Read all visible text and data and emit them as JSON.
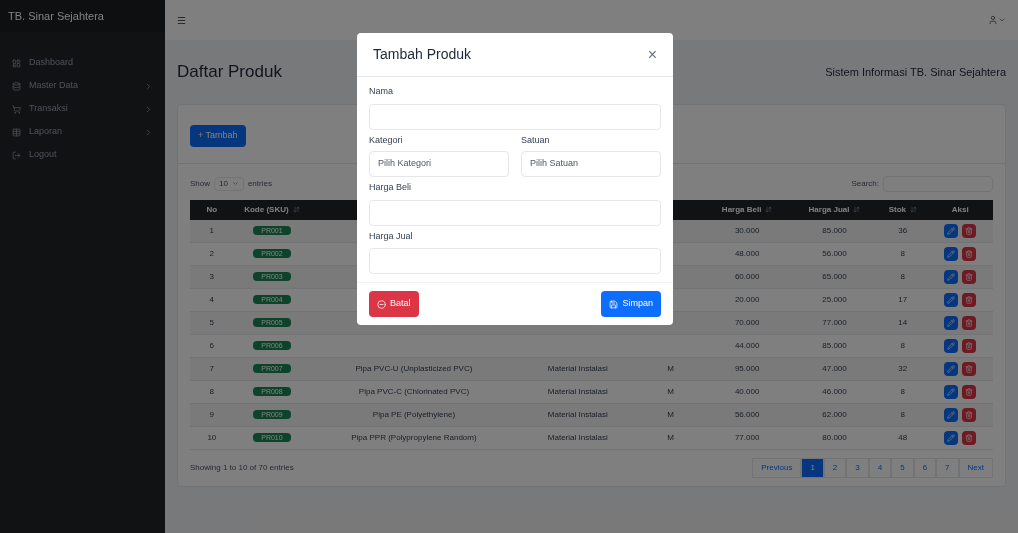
{
  "sidebar": {
    "brand": "TB. Sinar Sejahtera",
    "items": [
      {
        "label": "Dashboard",
        "has_submenu": false
      },
      {
        "label": "Master Data",
        "has_submenu": true
      },
      {
        "label": "Transaksi",
        "has_submenu": true
      },
      {
        "label": "Laporan",
        "has_submenu": true
      },
      {
        "label": "Logout",
        "has_submenu": false
      }
    ]
  },
  "topbar": {
    "menu": "☰"
  },
  "page": {
    "title": "Daftar Produk",
    "subtitle": "Sistem Informasi TB. Sinar Sejahtera"
  },
  "card": {
    "add_button": "+ Tambah",
    "show_label": "Show",
    "page_size": "10",
    "entries_label": "entries",
    "search_label": "Search:",
    "columns": [
      {
        "label": "No",
        "sortable": false
      },
      {
        "label": "Kode (SKU)",
        "sortable": true
      },
      {},
      {},
      {},
      {
        "label": "Harga Beli",
        "sortable": true
      },
      {
        "label": "Harga Jual",
        "sortable": true
      },
      {
        "label": "Stok",
        "sortable": true
      },
      {
        "label": "Aksi",
        "sortable": false
      }
    ],
    "rows": [
      {
        "no": "1",
        "code": "PR001",
        "buy": "30.000",
        "sell": "85.000",
        "stock": "36"
      },
      {
        "no": "2",
        "code": "PR002",
        "buy": "48.000",
        "sell": "56.000",
        "stock": "8"
      },
      {
        "no": "3",
        "code": "PR003",
        "buy": "60.000",
        "sell": "65.000",
        "stock": "8"
      },
      {
        "no": "4",
        "code": "PR004",
        "buy": "20.000",
        "sell": "25.000",
        "stock": "17"
      },
      {
        "no": "5",
        "code": "PR005",
        "buy": "70.000",
        "sell": "77.000",
        "stock": "14"
      },
      {
        "no": "6",
        "code": "PR006",
        "buy": "44.000",
        "sell": "85.000",
        "stock": "8"
      },
      {
        "no": "7",
        "code": "PR007",
        "name": "Pipa PVC-U (Unplasticized PVC)",
        "category": "Material Instalasi",
        "unit": "M",
        "buy": "95.000",
        "sell": "47.000",
        "stock": "32"
      },
      {
        "no": "8",
        "code": "PR008",
        "name": "Pipa PVC-C (Chlorinated PVC)",
        "category": "Material Instalasi",
        "unit": "M",
        "buy": "40.000",
        "sell": "46.000",
        "stock": "8"
      },
      {
        "no": "9",
        "code": "PR009",
        "name": "Pipa PE (Polyethylene)",
        "category": "Material Instalasi",
        "unit": "M",
        "buy": "56.000",
        "sell": "62.000",
        "stock": "8"
      },
      {
        "no": "10",
        "code": "PR010",
        "name": "Pipa PPR (Polypropylene Random)",
        "category": "Material Instalasi",
        "unit": "M",
        "buy": "77.000",
        "sell": "80.000",
        "stock": "48"
      }
    ],
    "info": "Showing 1 to 10 of 70 entries",
    "pagination": [
      {
        "label": "Previous",
        "selected": false
      },
      {
        "label": "1",
        "selected": true
      },
      {
        "label": "2",
        "selected": false
      },
      {
        "label": "3",
        "selected": false
      },
      {
        "label": "4",
        "selected": false
      },
      {
        "label": "5",
        "selected": false
      },
      {
        "label": "6",
        "selected": false
      },
      {
        "label": "7",
        "selected": false
      },
      {
        "label": "Next",
        "selected": false
      }
    ]
  },
  "modal": {
    "title": "Tambah Produk",
    "close": "×",
    "fields": [
      {
        "label": "Nama",
        "kind": "input"
      },
      {
        "label": "Kategori",
        "kind": "select",
        "placeholder": "Pilih Kategori"
      },
      {
        "label": "Satuan",
        "kind": "select",
        "placeholder": "Pilih Satuan"
      },
      {
        "label": "Harga Beli",
        "kind": "input"
      },
      {
        "label": "Harga Jual",
        "kind": "input"
      }
    ],
    "cancel": "Batal",
    "save": "Simpan"
  }
}
